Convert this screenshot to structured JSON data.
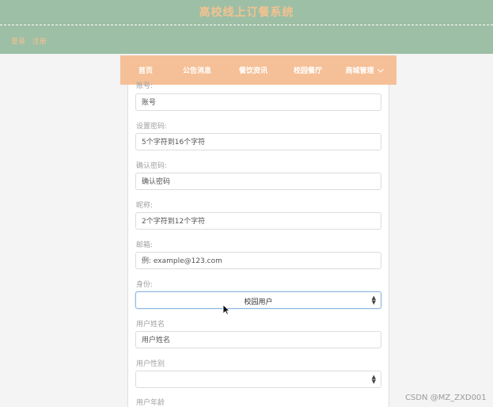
{
  "header": {
    "title": "高校线上订餐系统",
    "auth_links": [
      "登录",
      "注册"
    ]
  },
  "nav": {
    "items": [
      "首页",
      "公告消息",
      "餐饮资讯",
      "校园餐厅",
      "商城管理"
    ]
  },
  "form": {
    "fields": [
      {
        "label": "账号:",
        "value": "账号"
      },
      {
        "label": "设置密码:",
        "value": "5个字符到16个字符"
      },
      {
        "label": "确认密码:",
        "value": "确认密码"
      },
      {
        "label": "昵称:",
        "value": "2个字符到12个字符"
      },
      {
        "label": "邮箱:",
        "value": "例: example@123.com"
      },
      {
        "label": "身份:",
        "value": "校园用户"
      },
      {
        "label": "用户姓名",
        "value": "用户姓名"
      },
      {
        "label": "用户性别",
        "value": ""
      },
      {
        "label": "用户年龄",
        "value": ""
      }
    ]
  },
  "watermark": "CSDN @MZ_ZXD001",
  "colors": {
    "header_bg": "#9dbfa5",
    "accent_peach": "#f5c097",
    "title_text": "#f5c28f",
    "select_focus": "#8fb6e3"
  },
  "icons": {
    "nav_dropdown": "chevron-down-icon",
    "select_arrows": "up-down-caret-icon",
    "mouse_cursor": "mouse-pointer-icon"
  }
}
